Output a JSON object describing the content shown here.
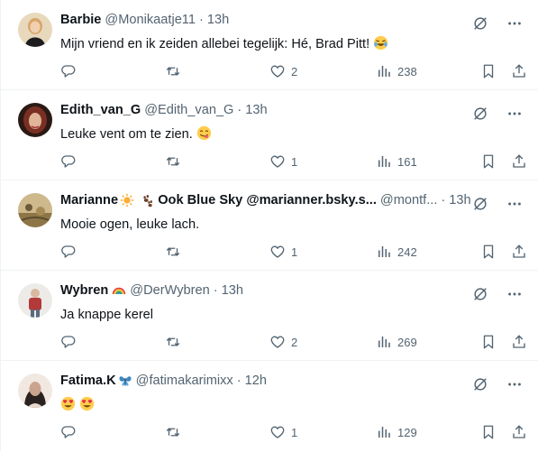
{
  "tweets": [
    {
      "name": "Barbie",
      "handle": "@Monikaatje11",
      "time": "13h",
      "text": "Mijn vriend en ik zeiden allebei tegelijk: Hé, Brad Pitt!",
      "emoji": "face-with-tears-of-joy",
      "likes": "2",
      "views": "238",
      "avatar_colors": [
        "#c9b38a",
        "#1d1d1f",
        "#e7d3b5"
      ]
    },
    {
      "name": "Edith_van_G",
      "handle": "@Edith_van_G",
      "time": "13h",
      "text": "Leuke vent om te zien.",
      "emoji": "face-savoring-food",
      "likes": "1",
      "views": "161",
      "avatar_colors": [
        "#3a2018",
        "#8e3b2d",
        "#e2b79a"
      ]
    },
    {
      "name": "Marianne",
      "name_suffix": "Ook Blue Sky @marianner.bsky.s...",
      "name_badges": [
        "sun-emoji",
        "paw-prints-emoji"
      ],
      "handle": "@montf...",
      "time": "13h",
      "text": "Mooie ogen, leuke lach.",
      "likes": "1",
      "views": "242",
      "avatar_colors": [
        "#a8874f",
        "#d5c29a",
        "#6b5a38"
      ]
    },
    {
      "name": "Wybren",
      "name_badges": [
        "rainbow-emoji"
      ],
      "handle": "@DerWybren",
      "time": "13h",
      "text": "Ja knappe kerel",
      "likes": "2",
      "views": "269",
      "avatar_colors": [
        "#e9e7e4",
        "#b23a3a",
        "#d9b8a0"
      ]
    },
    {
      "name": "Fatima.K",
      "name_badges": [
        "blue-butterfly-emoji"
      ],
      "handle": "@fatimakarimixx",
      "time": "12h",
      "text": "",
      "emoji_text": [
        "smiling-face-with-heart-eyes",
        "smiling-face-with-heart-eyes"
      ],
      "likes": "1",
      "views": "129",
      "avatar_colors": [
        "#2a2220",
        "#caa48e",
        "#f1e4dc"
      ]
    }
  ],
  "dot": "·",
  "colors": {
    "text": "#0f1419",
    "secondary": "#536471",
    "border": "#eff3f4"
  }
}
